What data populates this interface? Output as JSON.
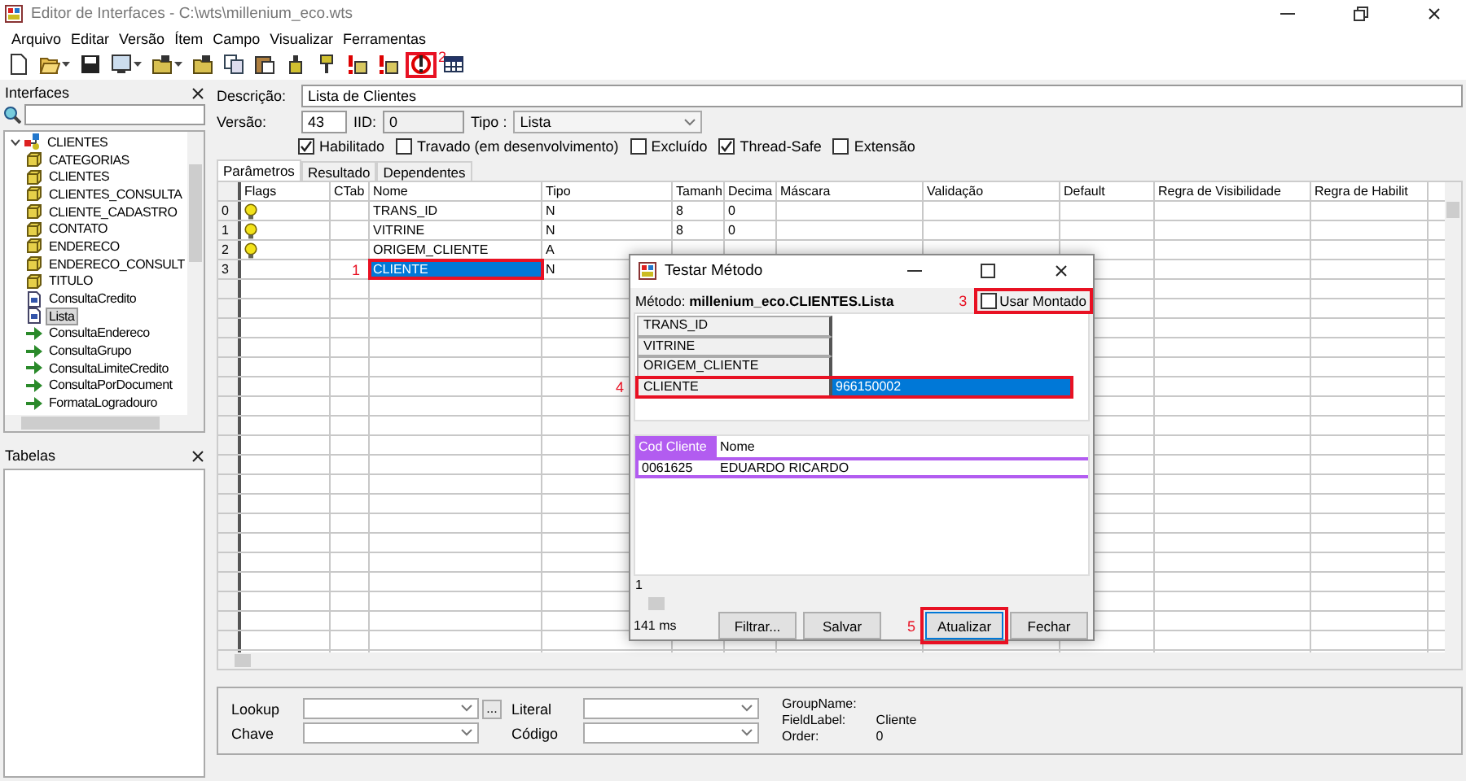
{
  "window": {
    "title": "Editor de Interfaces - C:\\wts\\millenium_eco.wts"
  },
  "menu": [
    "Arquivo",
    "Editar",
    "Versão",
    "Ítem",
    "Campo",
    "Visualizar",
    "Ferramentas"
  ],
  "toolbar": [
    {
      "kind": "new",
      "dropdown": false,
      "highlighted": false
    },
    {
      "kind": "open",
      "dropdown": true,
      "highlighted": false
    },
    {
      "kind": "save",
      "dropdown": false,
      "highlighted": false
    },
    {
      "kind": "preview",
      "dropdown": true,
      "highlighted": false
    },
    {
      "kind": "folder",
      "dropdown": true,
      "highlighted": false
    },
    {
      "kind": "folder",
      "dropdown": false,
      "highlighted": false
    },
    {
      "kind": "copy",
      "dropdown": false,
      "highlighted": false
    },
    {
      "kind": "paste",
      "dropdown": false,
      "highlighted": false
    },
    {
      "kind": "bottle",
      "dropdown": false,
      "highlighted": false
    },
    {
      "kind": "brush",
      "dropdown": false,
      "highlighted": false
    },
    {
      "kind": "alert",
      "dropdown": false,
      "highlighted": false
    },
    {
      "kind": "alert",
      "dropdown": false,
      "highlighted": false
    },
    {
      "kind": "run",
      "dropdown": false,
      "highlighted": true,
      "marker": "2"
    },
    {
      "kind": "table",
      "dropdown": false,
      "highlighted": false
    }
  ],
  "interfaces_panel": {
    "title": "Interfaces",
    "tree": [
      {
        "label": "CLIENTES",
        "kind": "root",
        "expanded": true,
        "selected": false,
        "children": [
          {
            "label": "CATEGORIAS",
            "kind": "table",
            "selected": false
          },
          {
            "label": "CLIENTES",
            "kind": "table",
            "selected": false
          },
          {
            "label": "CLIENTES_CONSULTA",
            "kind": "table",
            "selected": false
          },
          {
            "label": "CLIENTE_CADASTRO",
            "kind": "table",
            "selected": false
          },
          {
            "label": "CONTATO",
            "kind": "table",
            "selected": false
          },
          {
            "label": "ENDERECO",
            "kind": "table",
            "selected": false
          },
          {
            "label": "ENDERECO_CONSULT",
            "kind": "table",
            "selected": false
          },
          {
            "label": "TITULO",
            "kind": "table",
            "selected": false
          },
          {
            "label": "ConsultaCredito",
            "kind": "method",
            "selected": false
          },
          {
            "label": "Lista",
            "kind": "method",
            "selected": true
          },
          {
            "label": "ConsultaEndereco",
            "kind": "action",
            "selected": false
          },
          {
            "label": "ConsultaGrupo",
            "kind": "action",
            "selected": false
          },
          {
            "label": "ConsultaLimiteCredito",
            "kind": "action",
            "selected": false
          },
          {
            "label": "ConsultaPorDocument",
            "kind": "action",
            "selected": false
          },
          {
            "label": "FormataLogradouro",
            "kind": "action",
            "selected": false
          }
        ]
      }
    ]
  },
  "tables_panel": {
    "title": "Tabelas"
  },
  "form": {
    "description_label": "Descrição:",
    "description": "Lista de Clientes",
    "version_label": "Versão:",
    "version": "43",
    "iid_label": "IID:",
    "iid": "0",
    "type_label": "Tipo :",
    "type": "Lista",
    "checkboxes": [
      {
        "label": "Habilitado",
        "checked": true
      },
      {
        "label": "Travado (em desenvolvimento)",
        "checked": false
      },
      {
        "label": "Excluído",
        "checked": false
      },
      {
        "label": "Thread-Safe",
        "checked": true
      },
      {
        "label": "Extensão",
        "checked": false
      }
    ]
  },
  "tabs": [
    {
      "label": "Parâmetros",
      "selected": true
    },
    {
      "label": "Resultado",
      "selected": false
    },
    {
      "label": "Dependentes",
      "selected": false
    }
  ],
  "grid": {
    "columns": [
      "Flags",
      "CTab",
      "Nome",
      "Tipo",
      "Tamanh",
      "Decima",
      "Máscara",
      "Validação",
      "Default",
      "Regra de Visibilidade",
      "Regra de Habilit"
    ],
    "rows": [
      {
        "index": "0",
        "flag": true,
        "name": "TRANS_ID",
        "type": "N",
        "size": "8",
        "decimals": "0",
        "selected": false,
        "highlighted": false
      },
      {
        "index": "1",
        "flag": true,
        "name": "VITRINE",
        "type": "N",
        "size": "8",
        "decimals": "0",
        "selected": false,
        "highlighted": false
      },
      {
        "index": "2",
        "flag": true,
        "name": "ORIGEM_CLIENTE",
        "type": "A",
        "selected": false,
        "highlighted": false
      },
      {
        "index": "3",
        "flag": false,
        "name": "CLIENTE",
        "type": "N",
        "selected": true,
        "highlighted": true,
        "marker": "1"
      }
    ]
  },
  "dialog": {
    "title": "Testar Método",
    "method": "Método: **millenium_eco.CLIENTES.Lista**",
    "use_assembled": {
      "label": "Usar Montado",
      "checked": false,
      "highlighted": true,
      "marker": "3"
    },
    "params": [
      {
        "name": "TRANS_ID",
        "selected": false,
        "highlighted": false
      },
      {
        "name": "VITRINE",
        "selected": false,
        "highlighted": false
      },
      {
        "name": "ORIGEM_CLIENTE",
        "selected": false,
        "highlighted": false
      },
      {
        "name": "CLIENTE",
        "value": "966150002",
        "selected": true,
        "highlighted": true,
        "marker": "4"
      }
    ],
    "results": {
      "columns": [
        {
          "label": "Cod Cliente",
          "selected": true
        },
        {
          "label": "Nome",
          "selected": false
        }
      ],
      "rows": [
        {
          "cells": [
            "0061625",
            "EDUARDO RICARDO"
          ],
          "selected": true
        }
      ],
      "count": "1"
    },
    "elapsed": "141 ms",
    "buttons": [
      {
        "label": "Filtrar...",
        "highlighted": false
      },
      {
        "label": "Salvar",
        "highlighted": false
      },
      {
        "label": "Atualizar",
        "highlighted": true,
        "marker": "5"
      },
      {
        "label": "Fechar",
        "highlighted": false
      }
    ]
  },
  "field_panel": {
    "lookup_label": "Lookup",
    "browse": "...",
    "key_label": "Chave",
    "literal_label": "Literal",
    "code_label": "Código",
    "info": [
      {
        "label": "GroupName:"
      },
      {
        "label": "FieldLabel:",
        "value": "Cliente"
      },
      {
        "label": "Order:",
        "value": "0"
      }
    ]
  }
}
